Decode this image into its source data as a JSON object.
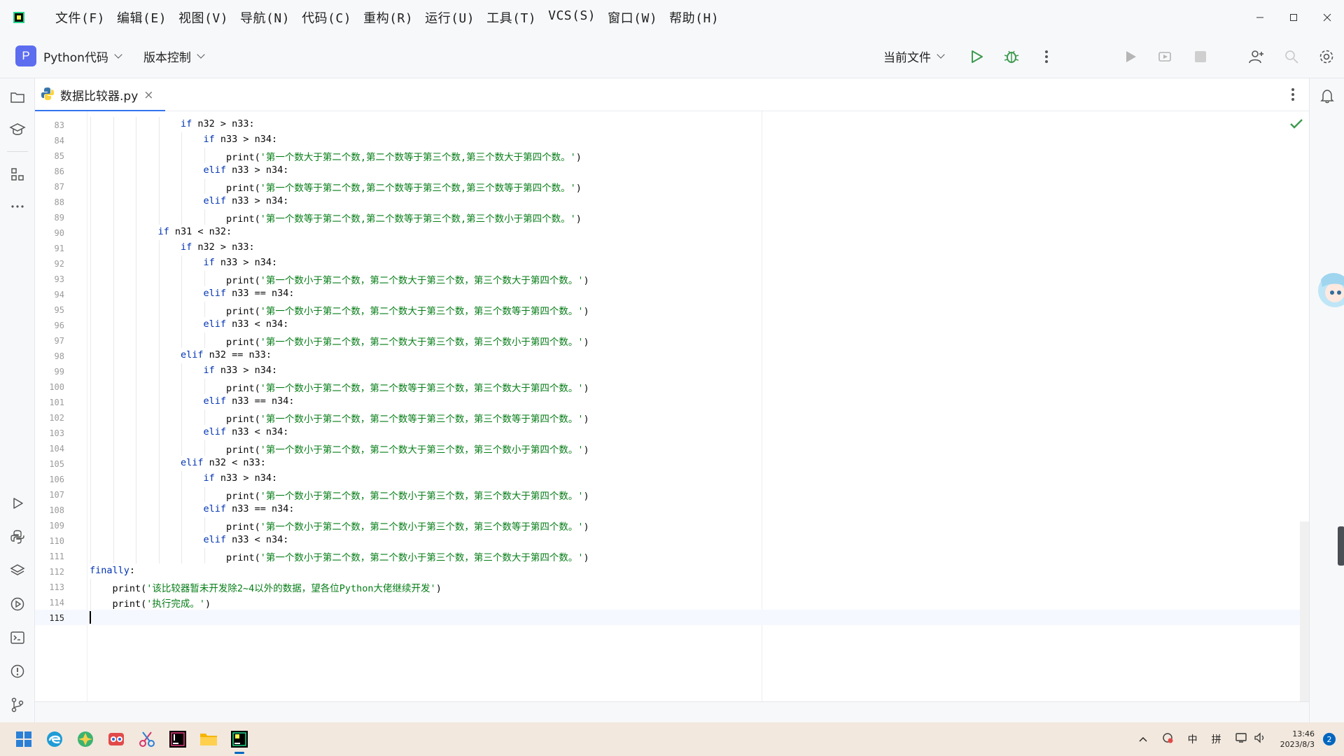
{
  "menu": [
    "文件(F)",
    "编辑(E)",
    "视图(V)",
    "导航(N)",
    "代码(C)",
    "重构(R)",
    "运行(U)",
    "工具(T)",
    "VCS(S)",
    "窗口(W)",
    "帮助(H)"
  ],
  "toolbar": {
    "project_initial": "P",
    "project_name": "Python代码",
    "vcs_label": "版本控制",
    "run_config": "当前文件"
  },
  "tab": {
    "filename": "数据比较器.py",
    "close": "×"
  },
  "editor": {
    "lines": [
      {
        "num": "83",
        "indent": 4,
        "kw": "if",
        "rest": " n32 > n33:"
      },
      {
        "num": "84",
        "indent": 5,
        "kw": "if",
        "rest": " n33 > n34:"
      },
      {
        "num": "85",
        "indent": 6,
        "fn": "print(",
        "str": "'第一个数大于第二个数,第二个数等于第三个数,第三个数大于第四个数。'",
        "end": ")"
      },
      {
        "num": "86",
        "indent": 5,
        "kw": "elif",
        "rest": " n33 > n34:"
      },
      {
        "num": "87",
        "indent": 6,
        "fn": "print(",
        "str": "'第一个数等于第二个数,第二个数等于第三个数,第三个数等于第四个数。'",
        "end": ")"
      },
      {
        "num": "88",
        "indent": 5,
        "kw": "elif",
        "rest": " n33 > n34:"
      },
      {
        "num": "89",
        "indent": 6,
        "fn": "print(",
        "str": "'第一个数等于第二个数,第二个数等于第三个数,第三个数小于第四个数。'",
        "end": ")"
      },
      {
        "num": "90",
        "indent": 3,
        "kw": "if",
        "rest": " n31 < n32:"
      },
      {
        "num": "91",
        "indent": 4,
        "kw": "if",
        "rest": " n32 > n33:"
      },
      {
        "num": "92",
        "indent": 5,
        "kw": "if",
        "rest": " n33 > n34:"
      },
      {
        "num": "93",
        "indent": 6,
        "fn": "print(",
        "str": "'第一个数小于第二个数，第二个数大于第三个数，第三个数大于第四个数。'",
        "end": ")"
      },
      {
        "num": "94",
        "indent": 5,
        "kw": "elif",
        "rest": " n33 == n34:"
      },
      {
        "num": "95",
        "indent": 6,
        "fn": "print(",
        "str": "'第一个数小于第二个数，第二个数大于第三个数，第三个数等于第四个数。'",
        "end": ")"
      },
      {
        "num": "96",
        "indent": 5,
        "kw": "elif",
        "rest": " n33 < n34:"
      },
      {
        "num": "97",
        "indent": 6,
        "fn": "print(",
        "str": "'第一个数小于第二个数，第二个数大于第三个数，第三个数小于第四个数。'",
        "end": ")"
      },
      {
        "num": "98",
        "indent": 4,
        "kw": "elif",
        "rest": " n32 == n33:"
      },
      {
        "num": "99",
        "indent": 5,
        "kw": "if",
        "rest": " n33 > n34:"
      },
      {
        "num": "100",
        "indent": 6,
        "fn": "print(",
        "str": "'第一个数小于第二个数，第二个数等于第三个数，第三个数大于第四个数。'",
        "end": ")"
      },
      {
        "num": "101",
        "indent": 5,
        "kw": "elif",
        "rest": " n33 == n34:"
      },
      {
        "num": "102",
        "indent": 6,
        "fn": "print(",
        "str": "'第一个数小于第二个数，第二个数等于第三个数，第三个数等于第四个数。'",
        "end": ")"
      },
      {
        "num": "103",
        "indent": 5,
        "kw": "elif",
        "rest": " n33 < n34:"
      },
      {
        "num": "104",
        "indent": 6,
        "fn": "print(",
        "str": "'第一个数小于第二个数，第二个数大于第三个数，第三个数小于第四个数。'",
        "end": ")"
      },
      {
        "num": "105",
        "indent": 4,
        "kw": "elif",
        "rest": " n32 < n33:"
      },
      {
        "num": "106",
        "indent": 5,
        "kw": "if",
        "rest": " n33 > n34:"
      },
      {
        "num": "107",
        "indent": 6,
        "fn": "print(",
        "str": "'第一个数小于第二个数，第二个数小于第三个数，第三个数大于第四个数。'",
        "end": ")"
      },
      {
        "num": "108",
        "indent": 5,
        "kw": "elif",
        "rest": " n33 == n34:"
      },
      {
        "num": "109",
        "indent": 6,
        "fn": "print(",
        "str": "'第一个数小于第二个数，第二个数小于第三个数，第三个数等于第四个数。'",
        "end": ")"
      },
      {
        "num": "110",
        "indent": 5,
        "kw": "elif",
        "rest": " n33 < n34:"
      },
      {
        "num": "111",
        "indent": 6,
        "fn": "print(",
        "str": "'第一个数小于第二个数，第二个数小于第三个数，第三个数大于第四个数。'",
        "end": ")"
      },
      {
        "num": "112",
        "indent": 0,
        "kw": "finally",
        "rest": ":"
      },
      {
        "num": "113",
        "indent": 1,
        "fn": "print(",
        "str": "'该比较器暂未开发除2~4以外的数据，望各位Python大佬继续开发'",
        "end": ")"
      },
      {
        "num": "114",
        "indent": 1,
        "fn": "print(",
        "str": "'执行完成。'",
        "end": ")"
      },
      {
        "num": "115",
        "indent": 0,
        "current": true
      }
    ]
  },
  "taskbar": {
    "ime_lang": "中",
    "ime_mode": "拼",
    "time": "13:46",
    "date": "2023/8/3",
    "notifications": "2"
  },
  "colors": {
    "accent": "#3574f0",
    "keyword": "#0033b3",
    "string": "#067d17",
    "run_green": "#3d9a50"
  }
}
